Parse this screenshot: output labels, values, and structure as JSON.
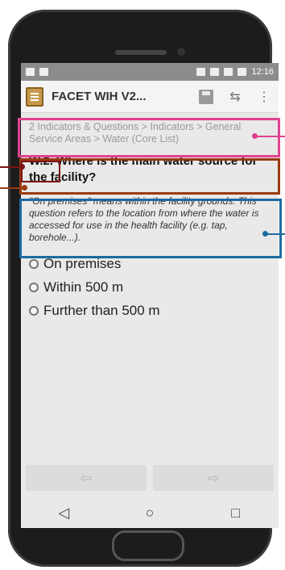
{
  "statusbar": {
    "time": "12:16"
  },
  "actionbar": {
    "title": "FACET WIH V2...",
    "app_icon": "clipboard-icon",
    "save_icon": "save-icon",
    "change_language_icon": "language-icon",
    "menu_icon": "overflow-menu-icon"
  },
  "breadcrumb": "2 Indicators & Questions > Indicators > General Service Areas > Water (Core List)",
  "question": {
    "label": "W.2. Where is the main water source for the facility?"
  },
  "hint": "\"On premises\" means within the facility grounds. This question refers to the location from where the water is accessed for use in the health facility (e.g. tap, borehole...).",
  "options": [
    {
      "label": "On premises"
    },
    {
      "label": "Within 500 m"
    },
    {
      "label": "Further than 500 m"
    }
  ],
  "navigation": {
    "back_icon": "arrow-left-icon",
    "next_icon": "arrow-right-icon"
  },
  "softkeys": {
    "back": "◁",
    "home": "○",
    "recents": "□"
  },
  "colors": {
    "breadcrumb_highlight": "#e0438e",
    "question_highlight": "#9a3b12",
    "code_highlight": "#7a1414",
    "hint_highlight": "#1d6aa1"
  }
}
